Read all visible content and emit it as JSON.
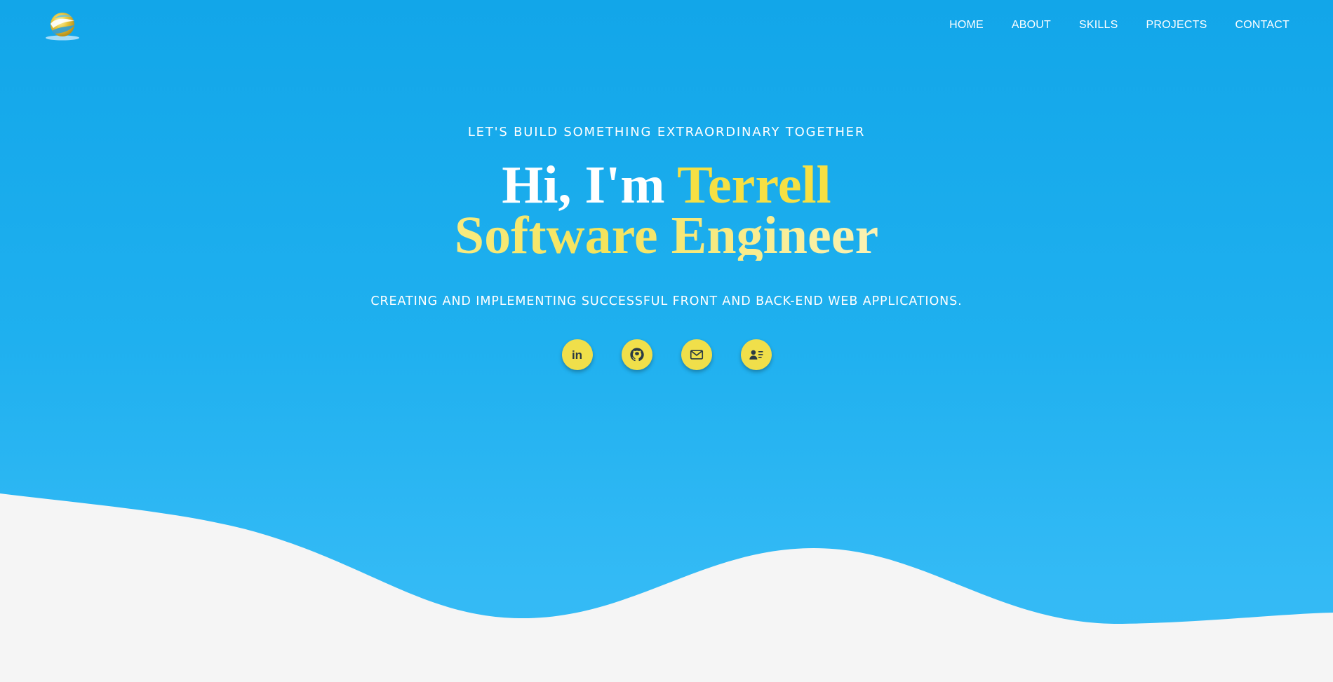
{
  "nav": {
    "logo_icon": "globe-swirl-icon",
    "items": [
      {
        "label": "HOME"
      },
      {
        "label": "ABOUT"
      },
      {
        "label": "SKILLS"
      },
      {
        "label": "PROJECTS"
      },
      {
        "label": "CONTACT"
      }
    ]
  },
  "hero": {
    "tagline": "LET'S BUILD SOMETHING EXTRAORDINARY TOGETHER",
    "greeting": "Hi, I'm",
    "name": "Terrell",
    "role": "Software Engineer",
    "subtitle": "CREATING AND IMPLEMENTING SUCCESSFUL FRONT AND BACK-END WEB APPLICATIONS."
  },
  "socials": [
    {
      "icon": "linkedin-icon",
      "text": "in"
    },
    {
      "icon": "github-icon"
    },
    {
      "icon": "mail-icon"
    },
    {
      "icon": "contact-card-icon"
    }
  ],
  "colors": {
    "hero_top": "#12a6e9",
    "hero_bottom": "#37bbf4",
    "accent_yellow": "#f0df4a",
    "name_yellow": "#f6e043",
    "page_bg": "#f5f5f5",
    "icon_dark": "#2a3a44"
  }
}
